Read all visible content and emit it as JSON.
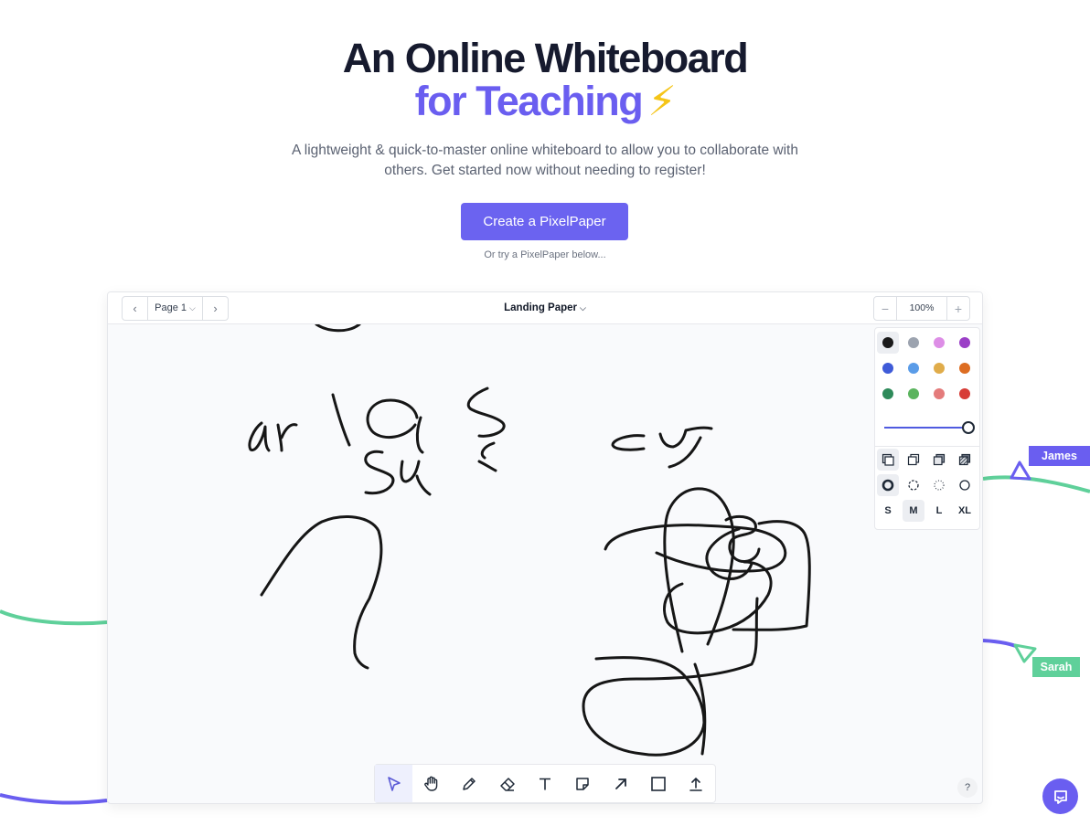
{
  "hero": {
    "title_line1": "An Online Whiteboard",
    "title_line2": "for Teaching",
    "title_emoji": "⚡",
    "subtitle": "A lightweight & quick-to-master online whiteboard to allow you to collaborate with others. Get started now without needing to register!",
    "cta_label": "Create a PixelPaper",
    "secondary_text": "Or try a PixelPaper below..."
  },
  "collaborators": [
    {
      "name": "James",
      "color": "#6a5ef0"
    },
    {
      "name": "Sarah",
      "color": "#5fd09a"
    }
  ],
  "board": {
    "page_label": "Page 1",
    "paper_name": "Landing Paper",
    "zoom_level": "100%",
    "zoom_out_symbol": "−",
    "zoom_in_symbol": "+",
    "help_label": "?"
  },
  "palette": {
    "colors": [
      "#1a1a1a",
      "#9ca3af",
      "#dd8ee6",
      "#9b3fc7",
      "#3f5bd8",
      "#5a9ce8",
      "#e0ac4a",
      "#dd6d22",
      "#2e8a5a",
      "#5bb45e",
      "#e47b7b",
      "#d73c36"
    ],
    "selected_color": "#1a1a1a",
    "opacity_value": 1.0,
    "fill_styles": [
      "fill-solid",
      "fill-outline",
      "fill-semi",
      "fill-hatch"
    ],
    "dash_styles": [
      "dash-solid",
      "dash-dashed",
      "dash-dotted",
      "dash-none"
    ],
    "sizes": [
      "S",
      "M",
      "L",
      "XL"
    ],
    "selected_size": "M"
  },
  "toolbar": {
    "tools": [
      "select-tool",
      "hand-tool",
      "pencil-tool",
      "eraser-tool",
      "text-tool",
      "sticky-note-tool",
      "arrow-tool",
      "rectangle-tool",
      "upload-tool"
    ],
    "active_tool": "select-tool"
  }
}
